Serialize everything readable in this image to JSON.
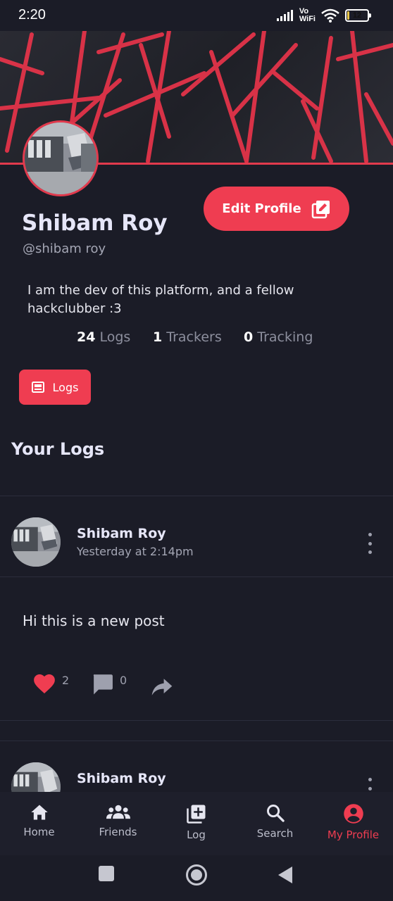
{
  "status": {
    "time": "2:20",
    "vo_wifi": [
      "Vo",
      "WiFi"
    ],
    "battery": "12",
    "battery_level": 0.12
  },
  "profile": {
    "name": "Shibam Roy",
    "handle": "@shibam roy",
    "bio": "I am the dev of this platform, and a fellow hackclubber :3",
    "edit_label": "Edit Profile",
    "stats": {
      "logs_count": "24",
      "logs_label": "Logs",
      "trackers_count": "1",
      "trackers_label": "Trackers",
      "tracking_count": "0",
      "tracking_label": "Tracking"
    },
    "logs_tab_label": "Logs"
  },
  "section_title": "Your Logs",
  "posts": [
    {
      "author": "Shibam Roy",
      "time": "Yesterday at 2:14pm",
      "body": "Hi this is a new post",
      "likes": "2",
      "comments": "0"
    },
    {
      "author": "Shibam Roy"
    }
  ],
  "nav": {
    "items": [
      {
        "label": "Home",
        "icon": "home-icon"
      },
      {
        "label": "Friends",
        "icon": "friends-icon"
      },
      {
        "label": "Log",
        "icon": "add-box-icon"
      },
      {
        "label": "Search",
        "icon": "search-icon"
      },
      {
        "label": "My Profile",
        "icon": "account-circle-icon"
      }
    ],
    "active": "My Profile"
  },
  "colors": {
    "accent": "#ef3d51",
    "background": "#1b1c27",
    "nav_background": "#1e1f2b",
    "heart": "#ef3d51"
  }
}
